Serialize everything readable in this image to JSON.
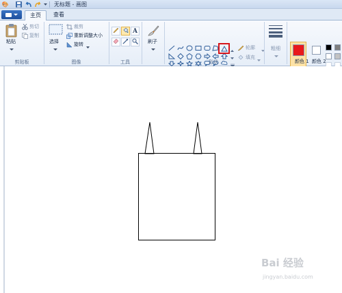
{
  "window": {
    "title": "无标题 - 画图"
  },
  "tabs": {
    "home": "主页",
    "view": "查看"
  },
  "clipboard": {
    "paste": "粘贴",
    "cut": "剪切",
    "copy": "复制",
    "label": "剪贴板"
  },
  "image": {
    "select": "选择",
    "crop": "裁剪",
    "resize": "重新调整大小",
    "rotate": "旋转",
    "label": "图像"
  },
  "tools": {
    "label": "工具"
  },
  "brushes": {
    "label": "刷子"
  },
  "shapes": {
    "outline": "轮廓",
    "fill": "填充",
    "label": "形状"
  },
  "size": {
    "label": "粗细"
  },
  "colors": {
    "color1": "颜色 1",
    "color2": "颜色 2",
    "color1_value": "#e8191c",
    "color2_value": "#ffffff"
  },
  "watermark": {
    "brand": "Bai 经验",
    "url": "jingyan.baidu.com"
  }
}
